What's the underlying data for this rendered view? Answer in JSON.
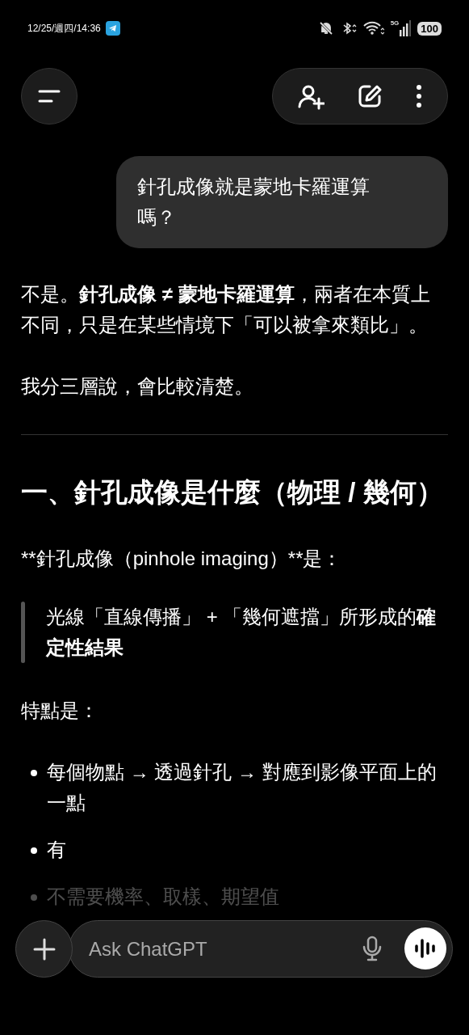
{
  "status_bar": {
    "time": "12/25/週四/14:36",
    "network": "5G",
    "battery": "100"
  },
  "composer": {
    "placeholder": "Ask ChatGPT"
  },
  "user_message": "針孔成像就是蒙地卡羅運算嗎？",
  "answer": [
    {
      "kind": "paragraph",
      "text": "不是。**針孔成像 ≠ 蒙地卡羅運算**，兩者在本質上不同，只是在某些情境下「可以被拿來類比」。"
    },
    {
      "kind": "paragraph",
      "text": "我分三層說，會比較清楚。"
    },
    {
      "kind": "divider"
    },
    {
      "kind": "heading",
      "text": "一、針孔成像是什麼（物理 / 幾何）"
    },
    {
      "kind": "plain",
      "text": "**針孔成像（pinhole imaging）**是："
    },
    {
      "kind": "quote",
      "text": "光線「直線傳播」 + 「幾何遮擋」所形成的**確定性結果**"
    },
    {
      "kind": "paragraph",
      "text": "特點是："
    },
    {
      "kind": "list",
      "items": [
        "每個物點 → 透過針孔 → 對應到影像平面上的一點",
        "有",
        "不需要機率、取樣、期望值"
      ]
    }
  ]
}
